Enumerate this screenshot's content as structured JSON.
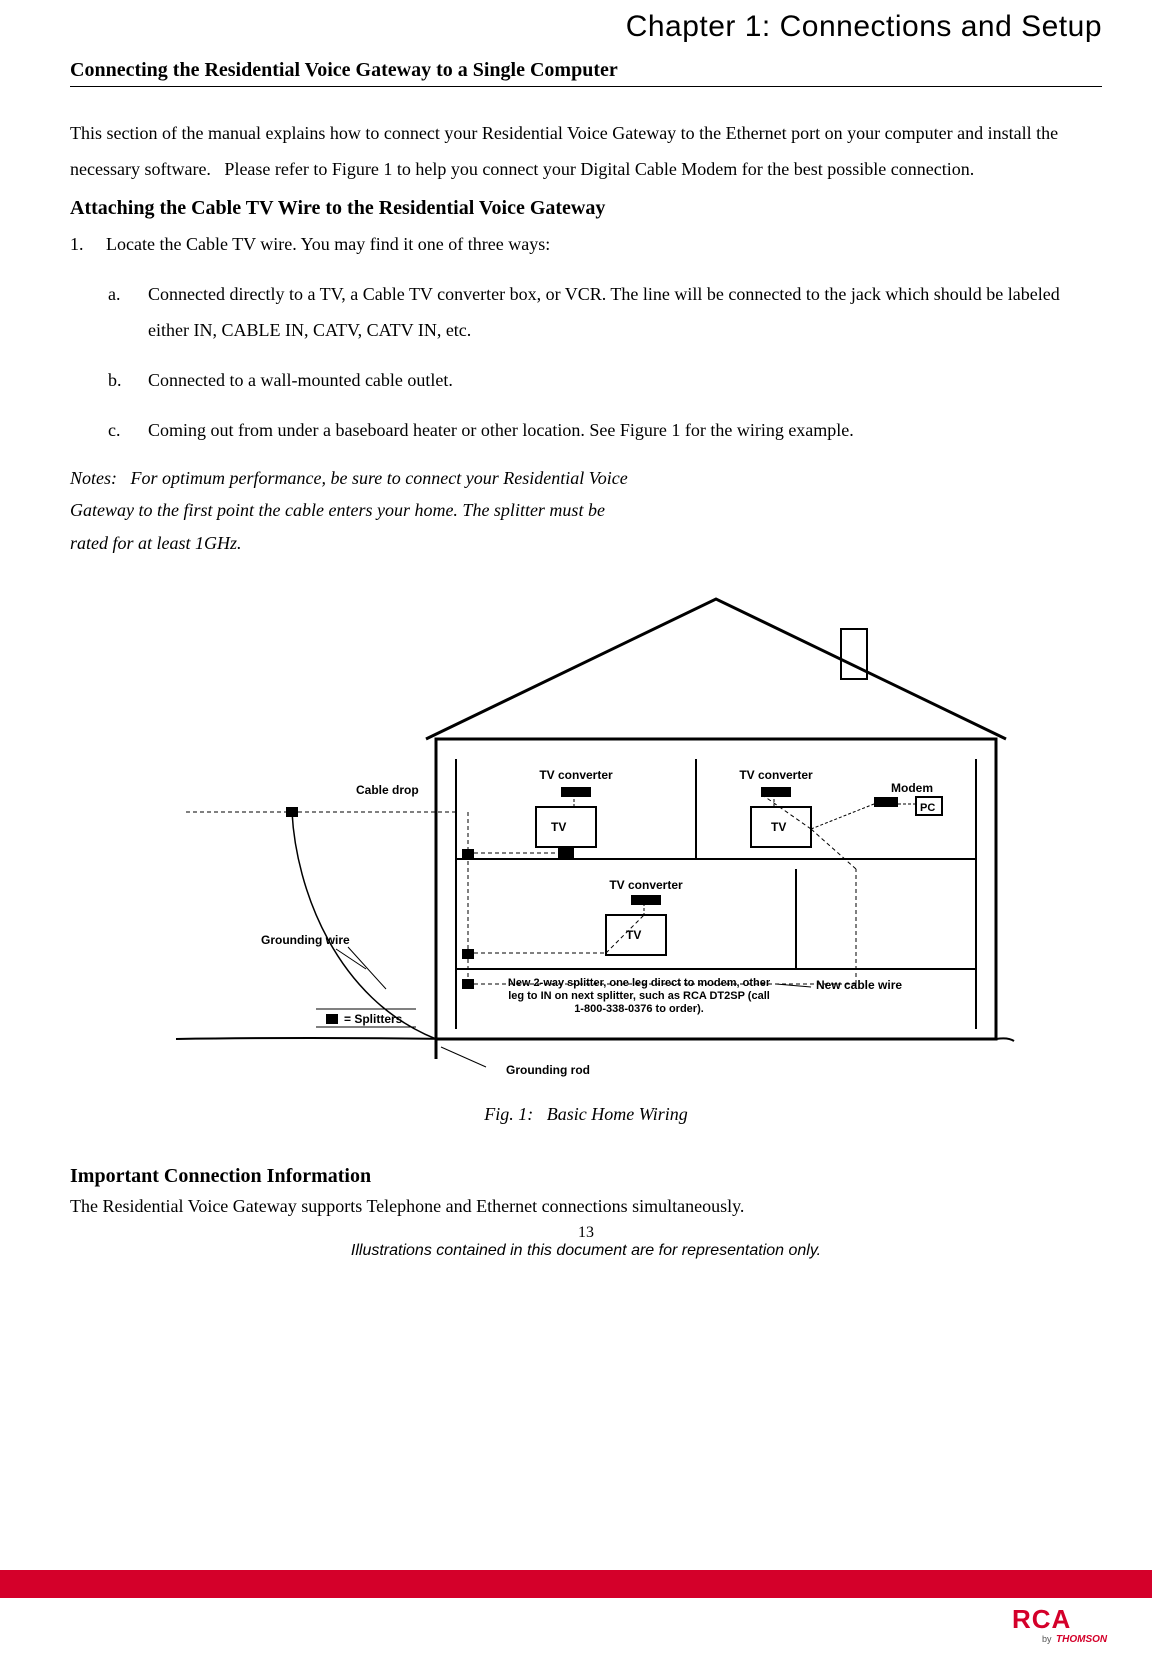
{
  "chapter": "Chapter 1: Connections and Setup",
  "h1": "Connecting the Residential Voice Gateway to a Single Computer",
  "p1": "This section of the manual explains how to connect your Residential Voice Gateway to the Ethernet port on your computer and install the necessary software.   Please refer to Figure 1 to help you connect your Digital Cable Modem for the best possible connection.",
  "h2": "Attaching the Cable TV Wire to the Residential Voice Gateway",
  "step1_num": "1.",
  "step1": "Locate the Cable TV wire. You may find it one of three ways:",
  "a_ltr": "a.",
  "a": "Connected directly to a TV, a Cable TV converter box, or VCR. The line will be connected to the jack which should be labeled either IN, CABLE IN, CATV, CATV IN, etc.",
  "b_ltr": "b.",
  "b": "Connected to a wall-mounted cable outlet.",
  "c_ltr": "c.",
  "c": "Coming out from under a baseboard heater or other location. See Figure 1 for the wiring example.",
  "notes": "Notes:   For optimum performance, be sure to connect your Residential Voice Gateway to the first point the cable enters your home. The splitter must be rated for at least 1GHz.",
  "diagram": {
    "cable_drop": "Cable drop",
    "grounding_wire": "Grounding wire",
    "splitters_legend": "= Splitters",
    "grounding_rod": "Grounding rod",
    "tv_converter": "TV converter",
    "tv": "TV",
    "modem": "Modem",
    "pc": "PC",
    "new_cable_wire": "New cable wire",
    "splitter_note": "New 2-way splitter, one leg direct to modem, other leg to IN on next splitter, such as RCA DT2SP (call 1-800-338-0376 to order)."
  },
  "fig_caption": "Fig. 1:   Basic Home Wiring",
  "h3": "Important Connection Information",
  "p2": "The Residential Voice Gateway supports Telephone and Ethernet connections simultaneously.",
  "page_num": "13",
  "footer": "Illustrations contained in this document are for representation only.",
  "logo_by": "by",
  "logo_thomson": "THOMSON"
}
